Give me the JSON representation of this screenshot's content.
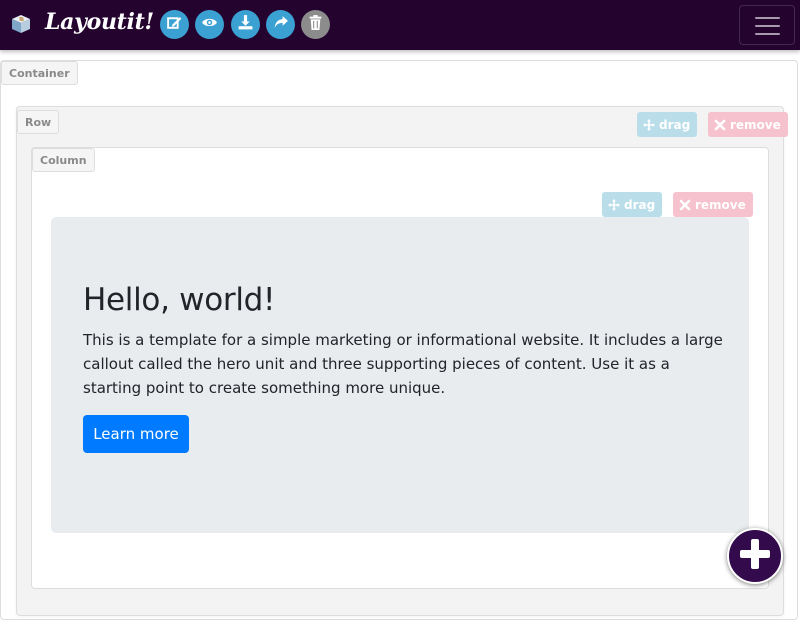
{
  "navbar": {
    "brand": "Layoutit!",
    "brand_icon": "cube-icon",
    "tools": [
      {
        "name": "edit-icon",
        "color": "#3ba0d2"
      },
      {
        "name": "eye-icon",
        "color": "#3ba0d2"
      },
      {
        "name": "download-icon",
        "color": "#3ba0d2"
      },
      {
        "name": "share-icon",
        "color": "#3ba0d2"
      },
      {
        "name": "trash-icon",
        "color": "#8c8c8c"
      }
    ],
    "menu_icon": "hamburger-icon",
    "background": "#24042f"
  },
  "container": {
    "label": "Container"
  },
  "row": {
    "label": "Row",
    "drag_label": "drag",
    "remove_label": "remove"
  },
  "column": {
    "label": "Column",
    "drag_label": "drag",
    "remove_label": "remove"
  },
  "hero": {
    "title": "Hello, world!",
    "text": "This is a template for a simple marketing or informational website. It includes a large callout called the hero unit and three supporting pieces of content. Use it as a starting point to create something more unique.",
    "button_label": "Learn more",
    "button_color": "#007bff"
  },
  "fab": {
    "icon": "plus-icon",
    "color": "#330a4c"
  }
}
